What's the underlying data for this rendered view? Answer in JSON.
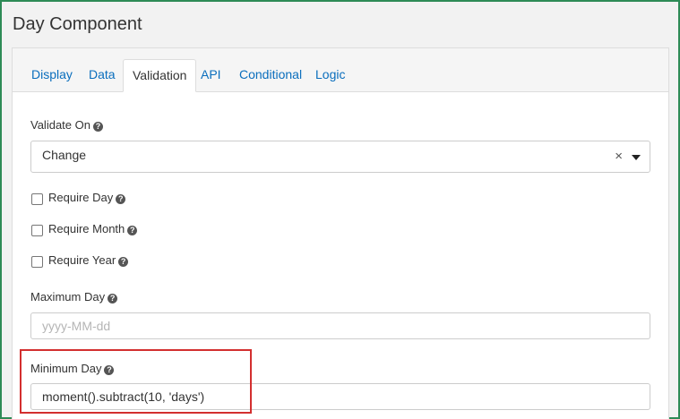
{
  "header": {
    "title": "Day Component"
  },
  "tabs": [
    {
      "label": "Display"
    },
    {
      "label": "Data"
    },
    {
      "label": "Validation"
    },
    {
      "label": "API"
    },
    {
      "label": "Conditional"
    },
    {
      "label": "Logic"
    }
  ],
  "active_tab": "Validation",
  "validate_on": {
    "label": "Validate On",
    "value": "Change"
  },
  "checkboxes": [
    {
      "label": "Require Day",
      "checked": false
    },
    {
      "label": "Require Month",
      "checked": false
    },
    {
      "label": "Require Year",
      "checked": false
    }
  ],
  "maximum_day": {
    "label": "Maximum Day",
    "placeholder": "yyyy-MM-dd",
    "value": ""
  },
  "minimum_day": {
    "label": "Minimum Day",
    "value": "moment().subtract(10, 'days')"
  },
  "icons": {
    "help": "question-circle-icon",
    "clear": "close-icon",
    "dropdown": "caret-down-icon"
  },
  "colors": {
    "accent": "#0a6ebd",
    "frame": "#2e8b57",
    "highlight": "#d32f2f"
  }
}
